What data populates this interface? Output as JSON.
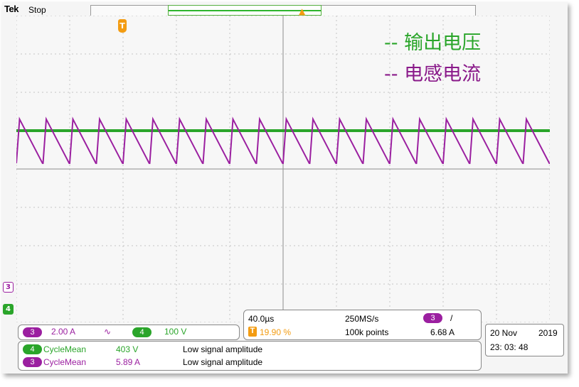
{
  "header": {
    "brand": "Tek",
    "run_state": "Stop"
  },
  "legend": {
    "output_voltage": "-- 输出电压",
    "inductor_current": "-- 电感电流"
  },
  "markers": {
    "trigger": "T",
    "trigger_pos": "▲",
    "ch3": "3",
    "ch4": "4"
  },
  "channel_settings": {
    "ch3_num": "3",
    "ch3_scale": "2.00 A",
    "ch3_bw_symbol": "∿",
    "ch4_num": "4",
    "ch4_scale": "100 V"
  },
  "acquisition": {
    "timebase": "40.0µs",
    "sample_rate": "250MS/s",
    "trigger_badge": "T",
    "trigger_position": "19.90 %",
    "record_length": "100k points",
    "trigger_source": "3",
    "trigger_slope": "/",
    "trigger_level": "6.68 A"
  },
  "measurements": [
    {
      "ch": "4",
      "name": "CycleMean",
      "value": "403 V",
      "status": "Low signal amplitude"
    },
    {
      "ch": "3",
      "name": "CycleMean",
      "value": "5.89 A",
      "status": "Low signal amplitude"
    }
  ],
  "datetime": {
    "date": "20 Nov",
    "year": "2019",
    "time": "23: 03: 48"
  },
  "colors": {
    "ch3": "#9b1fa0",
    "ch4": "#2aa52a",
    "trigger": "#f39c12"
  },
  "waveform": {
    "cycles": 20,
    "ch4_level_div": 1.0,
    "ch3_peak_div": 0.4,
    "ch3_valley_div": 1.3
  }
}
